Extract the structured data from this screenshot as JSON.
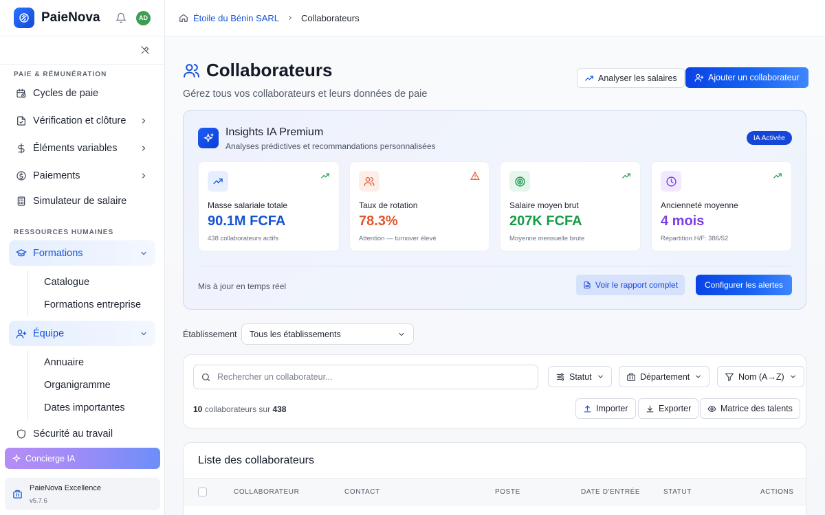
{
  "app": {
    "name": "PaieNova",
    "avatar_initials": "AD",
    "brand_color": "#1453d6"
  },
  "breadcrumb": {
    "company": "Étoile du Bénin SARL",
    "current": "Collaborateurs"
  },
  "sidebar": {
    "section_payroll": "PAIE & RÉMUNÉRATION",
    "payroll_items": [
      {
        "label": "Cycles de paie",
        "icon": "calendar-clock-icon"
      },
      {
        "label": "Vérification et clôture",
        "icon": "file-check-icon"
      },
      {
        "label": "Éléments variables",
        "icon": "dollar-icon"
      },
      {
        "label": "Paiements",
        "icon": "coin-icon"
      },
      {
        "label": "Simulateur de salaire",
        "icon": "calculator-icon"
      }
    ],
    "section_hr": "RESSOURCES HUMAINES",
    "formations": {
      "label": "Formations",
      "sub": [
        "Catalogue",
        "Formations entreprise"
      ]
    },
    "equipe": {
      "label": "Équipe",
      "sub": [
        "Annuaire",
        "Organigramme",
        "Dates importantes"
      ]
    },
    "security": "Sécurité au travail",
    "concierge": "Concierge IA",
    "version_name": "PaieNova Excellence",
    "version": "v5.7.6"
  },
  "header": {
    "title": "Collaborateurs",
    "subtitle": "Gérez tous vos collaborateurs et leurs données de paie",
    "analyze_button": "Analyser les salaires",
    "add_button": "Ajouter un collaborateur"
  },
  "insights": {
    "title": "Insights IA Premium",
    "subtitle": "Analyses prédictives et recommandations personnalisées",
    "badge": "IA Activée",
    "kpis": [
      {
        "label": "Masse salariale totale",
        "value": "90.1M FCFA",
        "note": "438 collaborateurs actifs",
        "color": "#1453d6",
        "icon": "trend-up-icon",
        "status_icon": "trend-up-icon"
      },
      {
        "label": "Taux de rotation",
        "value": "78.3%",
        "note": "Attention — turnover élevé",
        "color": "#e4572e",
        "icon": "users-icon",
        "status_icon": "warning-icon"
      },
      {
        "label": "Salaire moyen brut",
        "value": "207K FCFA",
        "note": "Moyenne mensuelle brute",
        "color": "#169b47",
        "icon": "target-icon",
        "status_icon": "trend-up-icon"
      },
      {
        "label": "Ancienneté moyenne",
        "value": "4 mois",
        "note": "Répartition H/F: 386/52",
        "color": "#7b3fe4",
        "icon": "clock-icon",
        "status_icon": "trend-up-icon"
      }
    ],
    "footer": "Mis à jour en temps réel",
    "report_button": "Voir le rapport complet",
    "alerts_button": "Configurer les alertes"
  },
  "filters": {
    "establishment_label": "Établissement",
    "establishment_value": "Tous les établissements",
    "search_placeholder": "Rechercher un collaborateur...",
    "status_chip": "Statut",
    "department_chip": "Département",
    "sort_chip": "Nom (A→Z)",
    "count_shown": "10",
    "count_mid": "collaborateurs sur",
    "count_total": "438",
    "import_button": "Importer",
    "export_button": "Exporter",
    "talent_button": "Matrice des talents"
  },
  "table": {
    "title": "Liste des collaborateurs",
    "columns": [
      "COLLABORATEUR",
      "CONTACT",
      "POSTE",
      "DATE D'ENTRÉE",
      "STATUT",
      "ACTIONS"
    ]
  }
}
